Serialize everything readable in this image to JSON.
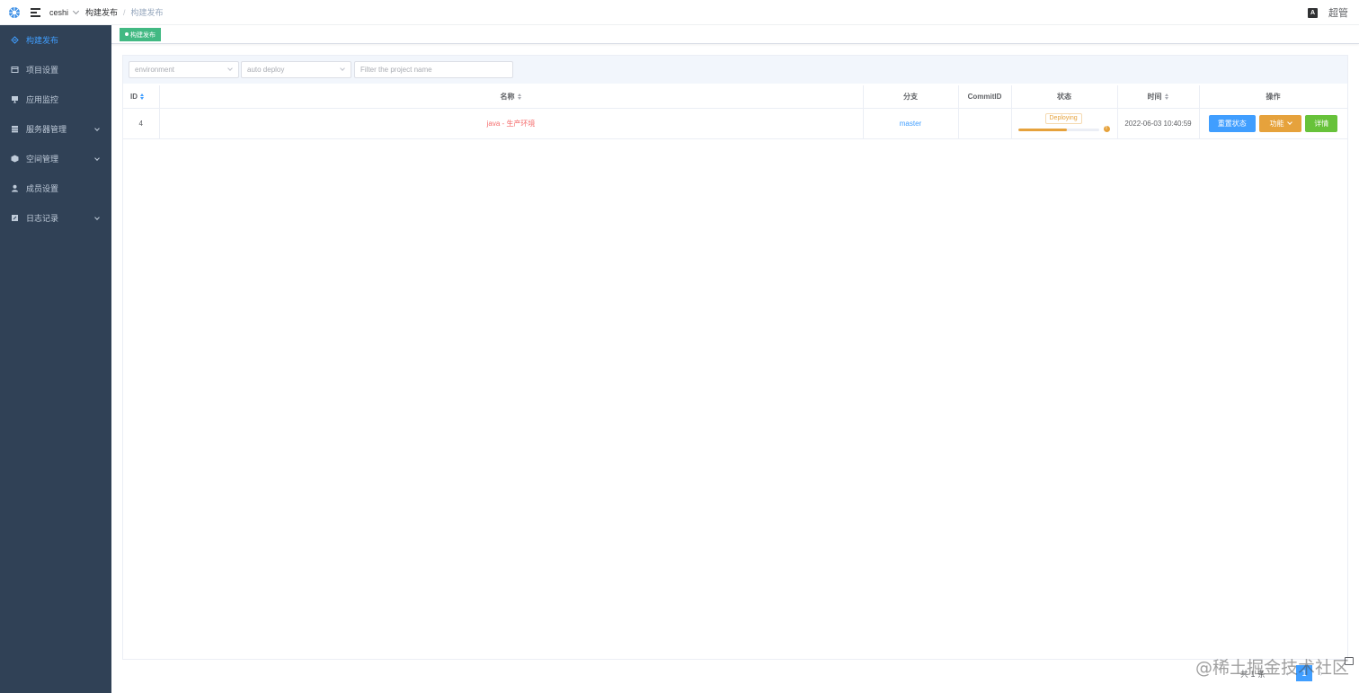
{
  "header": {
    "namespace": "ceshi",
    "breadcrumb": [
      "构建发布",
      "构建发布"
    ],
    "language_icon_label": "A",
    "user": "超管"
  },
  "sidebar": {
    "items": [
      {
        "label": "构建发布",
        "icon": "deploy-icon",
        "active": true,
        "has_children": false
      },
      {
        "label": "项目设置",
        "icon": "project-icon",
        "active": false,
        "has_children": false
      },
      {
        "label": "应用监控",
        "icon": "monitor-icon",
        "active": false,
        "has_children": false
      },
      {
        "label": "服务器管理",
        "icon": "server-icon",
        "active": false,
        "has_children": true
      },
      {
        "label": "空间管理",
        "icon": "namespace-icon",
        "active": false,
        "has_children": true
      },
      {
        "label": "成员设置",
        "icon": "member-icon",
        "active": false,
        "has_children": false
      },
      {
        "label": "日志记录",
        "icon": "log-icon",
        "active": false,
        "has_children": true
      }
    ]
  },
  "tags_view": {
    "active_tag": "构建发布"
  },
  "filters": {
    "environment_placeholder": "environment",
    "deploy_placeholder": "auto deploy",
    "project_placeholder": "Filter the project name"
  },
  "table": {
    "columns": [
      "ID",
      "名称",
      "分支",
      "CommitID",
      "状态",
      "时间",
      "操作"
    ],
    "rows": [
      {
        "id": "4",
        "name": "java - 生产环境",
        "branch": "master",
        "commit_id": "",
        "status": "Deploying",
        "progress_percent": 60,
        "time": "2022-06-03 10:40:59",
        "actions": [
          "重置状态",
          "功能",
          "详情"
        ]
      }
    ]
  },
  "pagination": {
    "total_text": "共 1 条",
    "current_page": "1"
  },
  "watermark": "@稀土掘金技术社区",
  "colors": {
    "sidebar_bg": "#304156",
    "active_menu": "#409eff",
    "tag_green": "#42b983",
    "primary": "#409eff",
    "warning": "#e6a23c",
    "success": "#67c23a",
    "danger": "#f56c6c"
  }
}
